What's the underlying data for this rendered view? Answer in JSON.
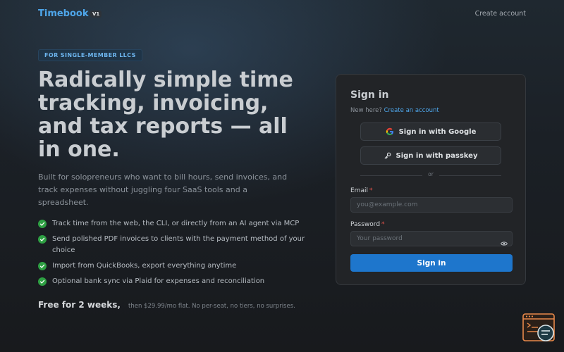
{
  "app": {
    "logo": "Timebook",
    "version": "V1",
    "create_account_link": "Create account"
  },
  "hero": {
    "badge": "FOR SINGLE-MEMBER LLCS",
    "title": "Radically simple time tracking, invoicing, and tax reports — all in one.",
    "description": "Built for solopreneurs who want to bill hours, send invoices, and track expenses without juggling four SaaS tools and a spreadsheet.",
    "features": [
      "Track time from the web, the CLI, or directly from an AI agent via MCP",
      "Send polished PDF invoices to clients with the payment method of your choice",
      "Import from QuickBooks, export everything anytime",
      "Optional bank sync via Plaid for expenses and reconciliation"
    ],
    "pricing_main": "Free for 2 weeks,",
    "pricing_sub": "then $29.99/mo flat. No per-seat, no tiers, no surprises."
  },
  "signin": {
    "title": "Sign in",
    "new_here": "New here?",
    "create_link": "Create an account",
    "google_button": "Sign in with Google",
    "passkey_button": "Sign in with passkey",
    "divider": "or",
    "email_label": "Email",
    "email_placeholder": "you@example.com",
    "email_value": "",
    "password_label": "Password",
    "password_placeholder": "Your password",
    "password_value": "",
    "required_marker": "*",
    "submit_button": "Sign in"
  },
  "icons": {
    "check": "check-circle-icon",
    "google": "google-icon",
    "passkey": "key-icon",
    "password_toggle": "eye-icon",
    "corner": "feedback-widget-icon"
  },
  "colors": {
    "accent": "#4ea6ea",
    "primary_button": "#1e76cc",
    "check": "#2ea043",
    "required": "#e5534b",
    "widget": "#e8894a"
  }
}
